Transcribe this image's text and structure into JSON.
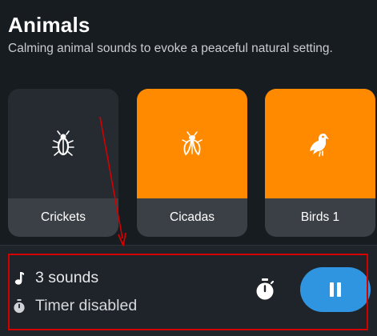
{
  "header": {
    "title": "Animals",
    "subtitle": "Calming animal sounds to evoke a peaceful natural setting."
  },
  "cards": [
    {
      "label": "Crickets",
      "icon": "cricket-icon",
      "active": false
    },
    {
      "label": "Cicadas",
      "icon": "cicada-icon",
      "active": true
    },
    {
      "label": "Birds 1",
      "icon": "bird-icon",
      "active": true
    }
  ],
  "player": {
    "sounds_label": "3 sounds",
    "timer_label": "Timer disabled",
    "sounds_icon": "music-note-icon",
    "timer_icon": "stopwatch-icon",
    "timer_button_icon": "stopwatch-icon",
    "pause_icon": "pause-icon"
  },
  "colors": {
    "accent_orange": "#ff8a00",
    "accent_blue": "#2f95e0",
    "background": "#171c21",
    "annotation_red": "#d40000"
  }
}
